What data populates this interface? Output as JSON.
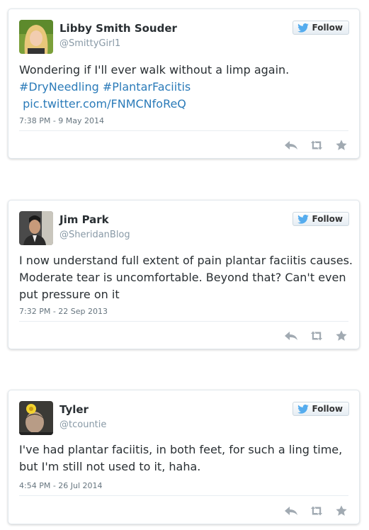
{
  "tweets": [
    {
      "name": "Libby Smith Souder",
      "handle": "@SmittyGirl1",
      "follow_label": "Follow",
      "text_lines": [
        "Wondering if I'll ever walk without a limp again.",
        "#DryNeedling #PlantarFaciitis",
        " pic.twitter.com/FNMCNfoReQ"
      ],
      "timestamp": "7:38 PM - 9 May 2014",
      "avatar": "avatar-blonde-woman"
    },
    {
      "name": "Jim Park",
      "handle": "@SheridanBlog",
      "follow_label": "Follow",
      "text_lines": [
        "I now understand full extent of pain plantar faciitis causes.",
        "Moderate tear is uncomfortable. Beyond that? Can't even",
        "put pressure on it"
      ],
      "timestamp": "7:32 PM - 22 Sep 2013",
      "avatar": "avatar-man-suit"
    },
    {
      "name": "Tyler",
      "handle": "@tcountie",
      "follow_label": "Follow",
      "text_lines": [
        "I've had plantar faciitis, in both feet, for such a ling time,",
        "but I'm still not used to it, haha."
      ],
      "timestamp": "4:54 PM - 26 Jul 2014",
      "avatar": "avatar-man-flower"
    }
  ],
  "colors": {
    "link": "#2b7bb9",
    "twitter_blue": "#55acee",
    "icon_gray": "#a1aab2"
  }
}
